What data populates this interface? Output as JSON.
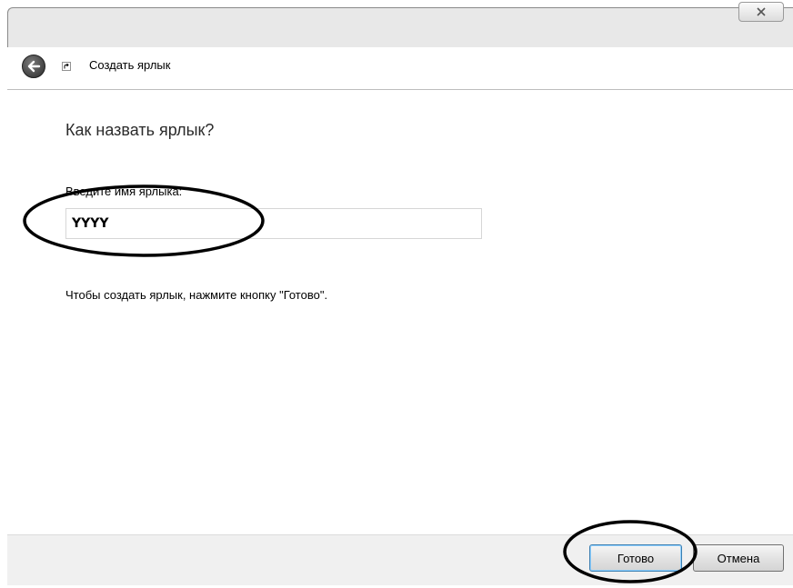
{
  "window": {
    "close_glyph": "☒"
  },
  "header": {
    "title": "Создать ярлык",
    "back_icon": "back-arrow-icon",
    "shortcut_icon": "shortcut-icon"
  },
  "main": {
    "heading": "Как назвать ярлык?",
    "name_label": "Введите имя ярлыка:",
    "name_value": "YYYY",
    "hint": "Чтобы создать ярлык, нажмите кнопку \"Готово\"."
  },
  "footer": {
    "done_label": "Готово",
    "cancel_label": "Отмена"
  },
  "colors": {
    "accent_border": "#3c7fb1",
    "annotation": "#000000"
  }
}
